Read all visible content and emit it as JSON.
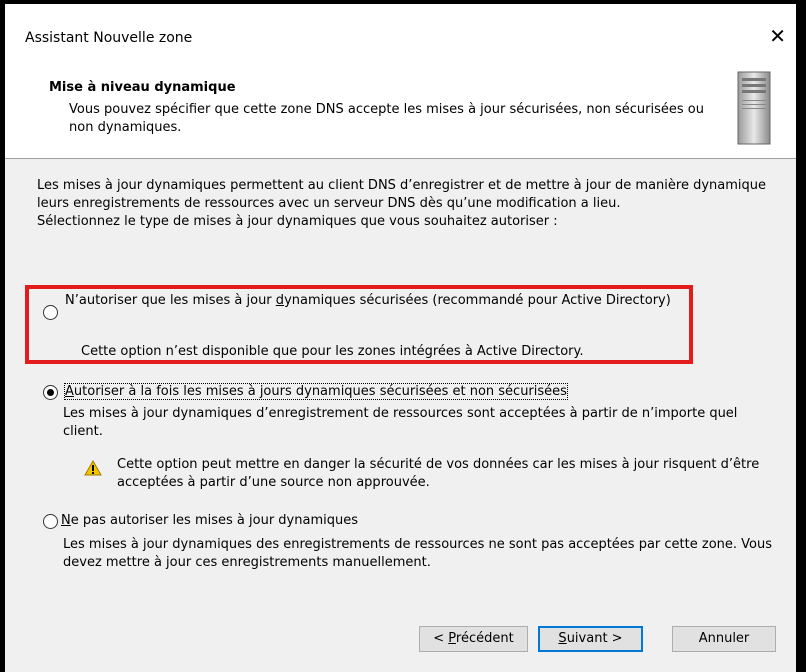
{
  "window": {
    "title": "Assistant Nouvelle zone",
    "close_glyph": "✕"
  },
  "header": {
    "title": "Mise à niveau dynamique",
    "description": "Vous pouvez spécifier que cette zone DNS accepte les mises à jour sécurisées, non sécurisées ou non dynamiques."
  },
  "intro": {
    "paragraph": "Les mises à jour dynamiques permettent au client DNS d’enregistrer et de mettre à jour de manière dynamique leurs enregistrements de ressources avec un serveur DNS dès qu’une modification a lieu.",
    "prompt": "Sélectionnez le type de mises à jour dynamiques que vous souhaitez autoriser :"
  },
  "options": [
    {
      "label_pre": "N’autoriser que les mises à jour ",
      "label_accel": "d",
      "label_post": "ynamiques sécurisées (recommandé pour Active Directory)",
      "description": "Cette option n’est disponible que pour les zones intégrées à Active Directory.",
      "checked": false,
      "enabled": false
    },
    {
      "label_pre": "",
      "label_accel": "A",
      "label_post": "utoriser à la fois les mises à jours dynamiques sécurisées et non sécurisées",
      "description": "Les mises à jour dynamiques d’enregistrement de ressources sont acceptées à partir de n’importe quel client.",
      "warning": "Cette option peut mettre en danger la sécurité de vos données car les mises à jour risquent d’être acceptées à partir d’une source non approuvée.",
      "checked": true,
      "enabled": true
    },
    {
      "label_pre": "",
      "label_accel": "N",
      "label_post": "e pas autoriser les mises à jour dynamiques",
      "description": "Les mises à jour dynamiques des enregistrements de ressources ne sont pas acceptées par cette zone. Vous devez mettre à jour ces enregistrements manuellement.",
      "checked": false,
      "enabled": true
    }
  ],
  "buttons": {
    "back_pre": "< ",
    "back_accel": "P",
    "back_post": "récédent",
    "next_accel": "S",
    "next_post": "uivant >",
    "cancel": "Annuler"
  },
  "colors": {
    "highlight": "#e41b1b",
    "warning": "#f5c400",
    "dialog_bg": "#f0f0f0"
  },
  "icons": {
    "header": "server-icon",
    "warning": "warning-icon",
    "close": "close-icon"
  }
}
